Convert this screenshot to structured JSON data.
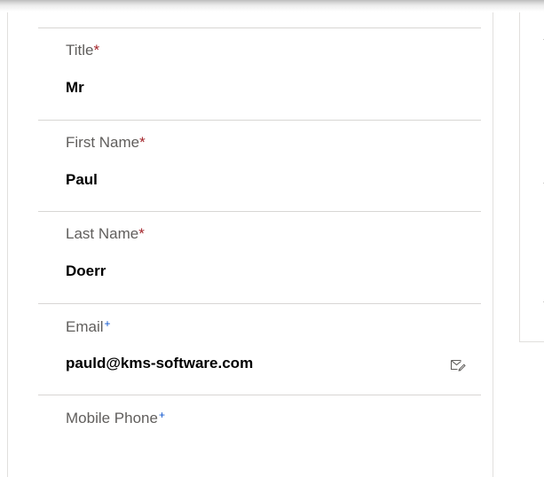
{
  "form": {
    "fields": [
      {
        "label": "Title",
        "indicator": "*",
        "value": "Mr"
      },
      {
        "label": "First Name",
        "indicator": "*",
        "value": "Paul"
      },
      {
        "label": "Last Name",
        "indicator": "*",
        "value": "Doerr"
      },
      {
        "label": "Email",
        "indicator": "+",
        "value": "pauld@kms-software.com"
      },
      {
        "label": "Mobile Phone",
        "indicator": "+",
        "value": ""
      }
    ],
    "email_icon": "email-compose-icon"
  },
  "colors": {
    "label": "#605e5c",
    "required": "#a4262c",
    "recommended": "#0b53ce",
    "divider": "#d8d6d4",
    "value": "#000000"
  }
}
